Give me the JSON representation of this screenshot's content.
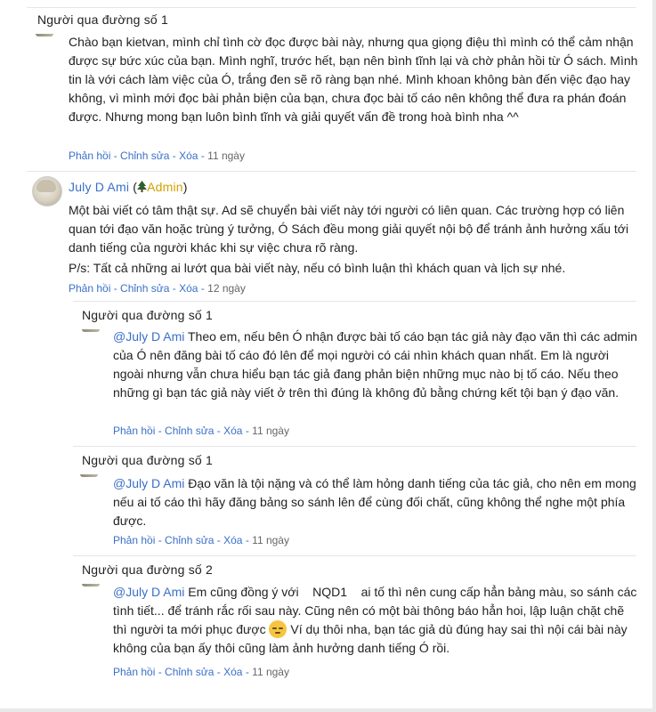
{
  "comments": [
    {
      "author": "Người qua đường số 1",
      "text": "Chào bạn kietvan, mình chỉ tình cờ đọc được bài này, nhưng qua giọng điệu thì mình có thể cảm nhận được sự bức xúc của bạn. Mình nghĩ, trước hết, bạn nên bình tĩnh lại và chờ phản hồi từ Ó sách. Mình tin là với cách làm việc của Ó, trắng đen sẽ rõ ràng bạn nhé. Mình khoan không bàn đến việc đạo hay không, vì mình mới đọc bài phản biện của bạn, chưa đọc bài tố cáo nên không thể đưa ra phán đoán được. Nhưng mong bạn luôn bình tĩnh và giải quyết vấn đề trong hoà bình nha ^^",
      "time": "11 ngày"
    },
    {
      "author": "July D Ami",
      "badge": "Admin",
      "text": "Một bài viết có tâm thật sự. Ad sẽ chuyển bài viết này tới người có liên quan. Các trường hợp có liên quan tới đạo văn hoặc trùng ý tưởng, Ó Sách đều mong giải quyết nội bộ để tránh ảnh hưởng xấu tới danh tiếng của người khác khi sự việc chưa rõ ràng.",
      "ps": "P/s: Tất cả những ai lướt qua bài viết này, nếu có bình luận thì khách quan và lịch sự nhé.",
      "time": "12 ngày"
    }
  ],
  "replies": [
    {
      "author": "Người qua đường số 1",
      "mention": "@July D Ami",
      "text": " Theo em, nếu bên Ó nhận được bài tố cáo bạn tác giả này đạo văn thì các admin của Ó nên đăng bài tố cáo đó lên để mọi người có cái nhìn khách quan nhất. Em là người ngoài nhưng vẫn chưa hiểu bạn tác giả đang phản biện những mục nào bị tố cáo. Nếu theo những gì bạn tác giả này viết ở trên thì đúng là không đủ bằng chứng kết tội bạn ý đạo văn.",
      "time": "11 ngày"
    },
    {
      "author": "Người qua đường số 1",
      "mention": "@July D Ami",
      "text": " Đạo văn là tội nặng và có thể làm hỏng danh tiếng của tác giả, cho nên em mong nếu ai tố cáo thì hãy đăng bảng so sánh lên để cùng đối chất, cũng không thể nghe một phía được.",
      "time": "11 ngày"
    },
    {
      "author": "Người qua đường số 2",
      "mention": "@July D Ami",
      "text_a": " Em cũng đồng ý với",
      "tag": "NQD1",
      "text_b": "ai tố thì nên cung cấp hẳn bảng màu, so sánh các tình tiết... để tránh rắc rối sau này. Cũng nên có một bài thông báo hẳn hoi, lập luận chặt chẽ thì người ta mới phục được",
      "text_c": " Ví dụ thôi nha, bạn tác giả dù đúng hay sai thì nội cái bài này không của bạn ấy thôi cũng làm ảnh hưởng danh tiếng Ó rồi.",
      "time": "11 ngày"
    }
  ],
  "actions": {
    "reply": "Phản hồi",
    "edit": "Chỉnh sửa",
    "delete": "Xóa",
    "sep": " - "
  },
  "colors": {
    "link": "#3a6fc9",
    "admin": "#d4a000"
  },
  "icons": {
    "admin_badge": "tree-icon",
    "emoji": "pensive-face-icon"
  }
}
